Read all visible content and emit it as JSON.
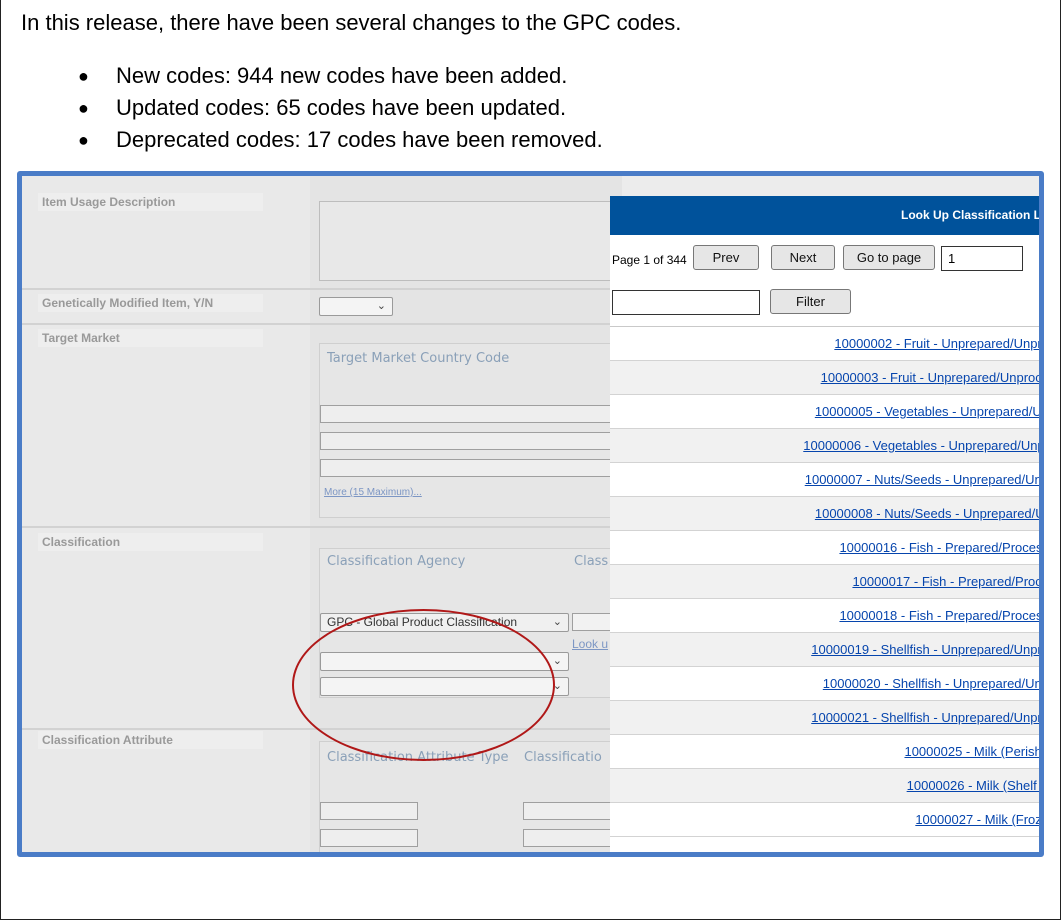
{
  "intro": "In this release, there have been several changes to the GPC codes.",
  "bullets": [
    "New codes: 944 new codes have been added.",
    "Updated codes: 65 codes have been updated.",
    "Deprecated codes: 17 codes have been removed."
  ],
  "form": {
    "item_usage_label": "Item Usage Description",
    "gmo_label": "Genetically Modified Item, Y/N",
    "gmo_value": "",
    "target_market_label": "Target Market",
    "target_market_col": "Target Market Country Code",
    "more_link": "More (15 Maximum)...",
    "classification_label": "Classification",
    "classification_agency_col": "Classification Agency",
    "classification_col2": "Class",
    "classification_agency_value": "GPC - Global Product Classification",
    "lookup_link": "Look u",
    "classification_attr_label": "Classification Attribute",
    "attr_type_col": "Classification Attribute Type",
    "attr_col2": "Classificatio"
  },
  "lookup": {
    "title": "Look Up Classification L",
    "page_info": "Page 1 of 344",
    "prev_label": "Prev",
    "next_label": "Next",
    "goto_label": "Go to page",
    "page_value": "1",
    "filter_label": "Filter",
    "filter_value": "",
    "items": [
      "10000002 - Fruit - Unprepared/Unpro",
      "10000003 - Fruit - Unprepared/Unproce",
      "10000005 - Vegetables - Unprepared/Un",
      "10000006 - Vegetables - Unprepared/Unpr",
      "10000007 - Nuts/Seeds - Unprepared/Unp",
      "10000008 - Nuts/Seeds - Unprepared/Ur",
      "10000016 - Fish - Prepared/Process",
      "10000017 - Fish - Prepared/Proce",
      "10000018 - Fish - Prepared/Process",
      "10000019 - Shellfish - Unprepared/Unpro",
      "10000020 - Shellfish - Unprepared/Unp",
      "10000021 - Shellfish - Unprepared/Unpro",
      "10000025 - Milk (Perisha",
      "10000026 - Milk (Shelf S",
      "10000027 - Milk (Froze"
    ]
  },
  "colors": {
    "header_blue": "#00529b",
    "frame_blue": "#4a7cc7",
    "annotation_red": "#b01818",
    "link_blue": "#0645ad"
  }
}
